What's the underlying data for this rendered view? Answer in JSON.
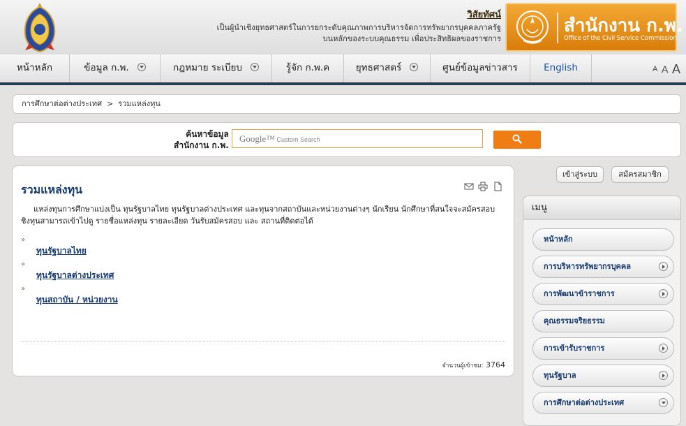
{
  "header": {
    "vision_title": "วิสัยทัศน์",
    "vision_line1": "เป็นผู้นำเชิงยุทธศาสตร์ในการยกระดับคุณภาพการบริหารจัดการทรัพยากรบุคคลภาครัฐ",
    "vision_line2": "บนหลักของระบบคุณธรรม เพื่อประสิทธิผลของราชการ",
    "logo_thai": "สำนักงาน ก.พ.",
    "logo_english": "Office of the Civil Service Commission",
    "accent_color": "#ef7d14"
  },
  "nav": {
    "items": [
      {
        "label": "หน้าหลัก"
      },
      {
        "label": "ข้อมูล ก.พ."
      },
      {
        "label": "กฎหมาย ระเบียบ"
      },
      {
        "label": "รู้จัก ก.พ.ค"
      },
      {
        "label": "ยุทธศาสตร์"
      },
      {
        "label": "ศูนย์ข้อมูลข่าวสาร"
      },
      {
        "label": "English"
      }
    ],
    "font_small": "A",
    "font_medium": "A",
    "font_large": "A"
  },
  "breadcrumb": {
    "parent": "การศึกษาต่อต่างประเทศ",
    "separator": ">",
    "current": "รวมแหล่งทุน"
  },
  "search": {
    "label_line1": "ค้นหาข้อมูล",
    "label_line2": "สำนักงาน ก.พ.",
    "google_label": "Google™",
    "placeholder": "Custom Search",
    "button_icon": "search-icon"
  },
  "content": {
    "title": "รวมแหล่งทุน",
    "intro": "แหล่งทุนการศึกษาแบ่งเป็น ทุนรัฐบาลไทย ทุนรัฐบาลต่างประเทศ และทุนจากสถาบันและหน่วยงานต่างๆ นักเรียน นักศึกษาที่สนใจจะสมัครสอบชิงทุนสามารถเข้าไปดู รายชื่อแหล่งทุน รายละเอียด วันรับสมัครสอบ และ สถานที่ติดต่อได้",
    "funds": [
      {
        "label": "ทุนรัฐบาลไทย"
      },
      {
        "label": "ทุนรัฐบาลต่างประเทศ"
      },
      {
        "label": "ทุนสถาบัน / หน่วยงาน"
      }
    ],
    "bullet": "»",
    "visitor_label": "จำนวนผู้เข้าชม:",
    "visitor_count": "3764"
  },
  "account": {
    "login": "เข้าสู่ระบบ",
    "register": "สมัครสมาชิก"
  },
  "menu": {
    "header": "เมนู",
    "items": [
      {
        "label": "หน้าหลัก",
        "arrow": "none"
      },
      {
        "label": "การบริหารทรัพยากรบุคคล",
        "arrow": "right"
      },
      {
        "label": "การพัฒนาข้าราชการ",
        "arrow": "right"
      },
      {
        "label": "คุณธรรมจริยธรรม",
        "arrow": "none"
      },
      {
        "label": "การเข้ารับราชการ",
        "arrow": "right"
      },
      {
        "label": "ทุนรัฐบาล",
        "arrow": "right"
      },
      {
        "label": "การศึกษาต่อต่างประเทศ",
        "arrow": "down"
      }
    ]
  }
}
